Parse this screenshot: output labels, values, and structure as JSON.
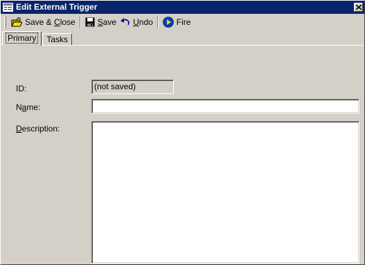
{
  "window": {
    "title": "Edit External Trigger",
    "icon": "form-icon",
    "close_glyph": "✕"
  },
  "toolbar": {
    "save_close": {
      "pre": "Save & ",
      "ul": "C",
      "post": "lose",
      "icon": "open-folder-icon"
    },
    "save": {
      "ul": "S",
      "post": "ave",
      "icon": "floppy-disk-icon"
    },
    "undo": {
      "ul": "U",
      "post": "ndo",
      "icon": "undo-arrow-icon"
    },
    "fire": {
      "label": "Fire",
      "icon": "fire-play-icon"
    }
  },
  "tabs": [
    {
      "label": "Primary",
      "active": true
    },
    {
      "label": "Tasks",
      "active": false
    }
  ],
  "form": {
    "id_label": "ID:",
    "id_value": "(not saved)",
    "name_label": {
      "pre": "N",
      "ul": "a",
      "post": "me:"
    },
    "name_value": "",
    "description_label": {
      "ul": "D",
      "post": "escription:"
    },
    "description_value": ""
  },
  "colors": {
    "titlebar": "#0a246a",
    "face": "#d4d0c8",
    "field_bg": "#ffffff"
  }
}
